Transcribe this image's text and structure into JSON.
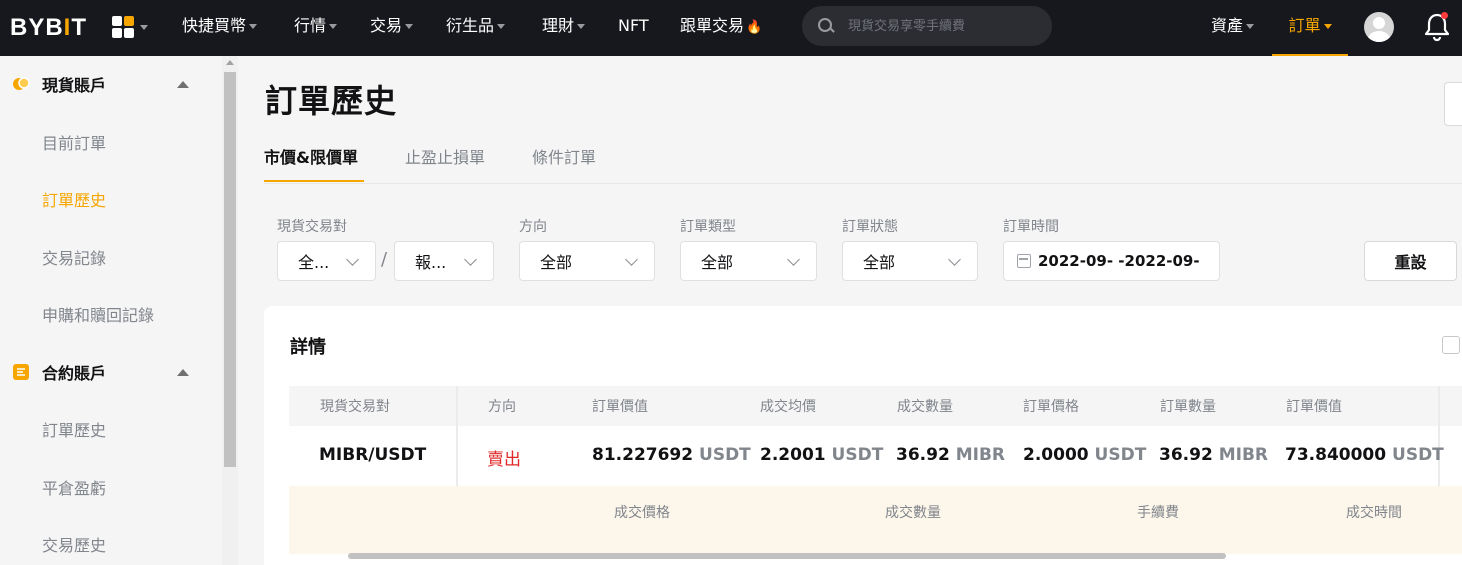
{
  "brand": {
    "logo": "BYBIT",
    "accent": "#f7a600"
  },
  "topnav": {
    "items": [
      {
        "label": "快捷買幣"
      },
      {
        "label": "行情"
      },
      {
        "label": "交易"
      },
      {
        "label": "衍生品"
      },
      {
        "label": "理財"
      },
      {
        "label": "NFT"
      },
      {
        "label": "跟單交易"
      }
    ],
    "search_placeholder": "現貨交易享零手續費",
    "assets": "資產",
    "orders": "訂單"
  },
  "sidebar": {
    "sections": [
      {
        "title": "現貨賬戶",
        "items": [
          "目前訂單",
          "訂單歷史",
          "交易記錄",
          "申購和贖回記錄"
        ]
      },
      {
        "title": "合約賬戶",
        "items": [
          "訂單歷史",
          "平倉盈虧",
          "交易歷史"
        ]
      }
    ]
  },
  "main": {
    "title": "訂單歷史",
    "tabs": [
      "市價&限價單",
      "止盈止損單",
      "條件訂單"
    ],
    "filters": {
      "pair_label": "現貨交易對",
      "pair_base": "全...",
      "pair_quote": "報...",
      "slash": "/",
      "side_label": "方向",
      "side_value": "全部",
      "type_label": "訂單類型",
      "type_value": "全部",
      "status_label": "訂單狀態",
      "status_value": "全部",
      "time_label": "訂單時間",
      "time_value": "2022-09-  -2022-09-",
      "reset": "重設"
    },
    "details": {
      "title": "詳情",
      "columns": [
        "現貨交易對",
        "方向",
        "訂單價值",
        "成交均價",
        "成交數量",
        "訂單價格",
        "訂單數量",
        "訂單價值"
      ],
      "row": {
        "pair": "MIBR/USDT",
        "side": "賣出",
        "order_value": "81.227692",
        "order_value_unit": "USDT",
        "avg_price": "2.2001",
        "avg_price_unit": "USDT",
        "filled_qty": "36.92",
        "filled_qty_unit": "MIBR",
        "order_price": "2.0000",
        "order_price_unit": "USDT",
        "order_qty": "36.92",
        "order_qty_unit": "MIBR",
        "order_value2": "73.840000",
        "order_value2_unit": "USDT"
      },
      "sub_columns": [
        "成交價格",
        "成交數量",
        "手續費",
        "成交時間"
      ]
    }
  }
}
